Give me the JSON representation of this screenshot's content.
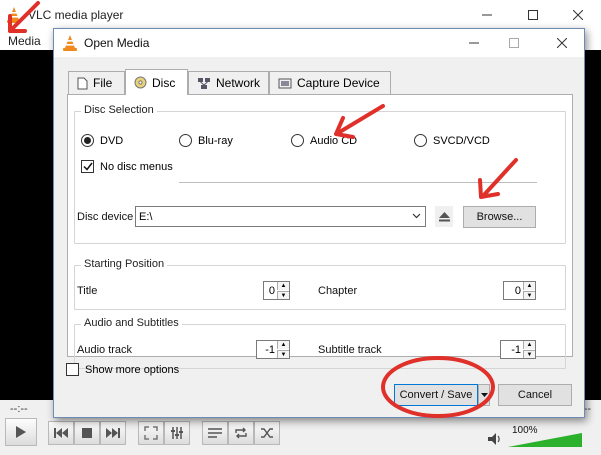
{
  "vlc": {
    "title": "VLC media player",
    "menu_label": "Media",
    "time_elapsed": "--:--",
    "time_remaining": "--:--",
    "volume": "100%",
    "volume_level": 1.0
  },
  "dialog": {
    "title": "Open Media",
    "tabs": [
      {
        "label": "File",
        "icon": "file-icon"
      },
      {
        "label": "Disc",
        "icon": "disc-icon"
      },
      {
        "label": "Network",
        "icon": "network-icon"
      },
      {
        "label": "Capture Device",
        "icon": "capture-device-icon"
      }
    ],
    "active_tab": "Disc",
    "disc_selection": {
      "title": "Disc Selection",
      "options": [
        "DVD",
        "Blu-ray",
        "Audio CD",
        "SVCD/VCD"
      ],
      "selected": "DVD",
      "no_disc_menus_label": "No disc menus",
      "no_disc_menus_checked": true,
      "device_label": "Disc device",
      "device_value": "E:\\",
      "browse_label": "Browse..."
    },
    "starting_position": {
      "title": "Starting Position",
      "title_label": "Title",
      "title_value": "0",
      "chapter_label": "Chapter",
      "chapter_value": "0"
    },
    "audio_subtitles": {
      "title": "Audio and Subtitles",
      "audio_label": "Audio track",
      "audio_value": "-1",
      "subtitle_label": "Subtitle track",
      "subtitle_value": "-1"
    },
    "show_more_label": "Show more options",
    "convert_label": "Convert / Save",
    "cancel_label": "Cancel"
  },
  "annotation_color": "#e0302a"
}
